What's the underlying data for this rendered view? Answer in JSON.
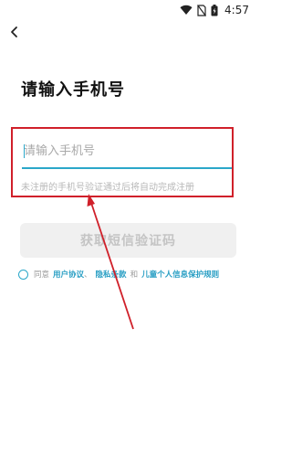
{
  "status_bar": {
    "time": "4:57",
    "icons": [
      "wifi-icon",
      "no-sim-icon",
      "battery-charging-icon"
    ]
  },
  "nav": {
    "back_icon": "chevron-left-icon"
  },
  "page": {
    "title": "请输入手机号"
  },
  "phone_input": {
    "placeholder": "请输入手机号",
    "value": ""
  },
  "hint": "未注册的手机号验证通过后将自动完成注册",
  "get_code_button": {
    "label": "获取短信验证码"
  },
  "agreement": {
    "prefix": "同意",
    "user_agreement": "用户协议",
    "separator": "、",
    "privacy_policy": "隐私条款",
    "conjunction": "和",
    "child_policy": "儿童个人信息保护规则"
  },
  "colors": {
    "accent": "#2aa7c9",
    "annotation": "#d0202a",
    "button_bg": "#f0f0f0",
    "button_text": "#c4c4c4"
  }
}
